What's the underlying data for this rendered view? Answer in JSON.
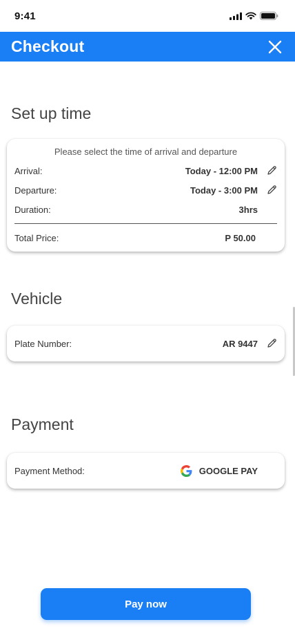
{
  "status_bar": {
    "time": "9:41"
  },
  "header": {
    "title": "Checkout"
  },
  "time_section": {
    "title": "Set up time",
    "note": "Please select the time of arrival and departure",
    "arrival_label": "Arrival:",
    "arrival_value": "Today - 12:00 PM",
    "departure_label": "Departure:",
    "departure_value": "Today - 3:00 PM",
    "duration_label": "Duration:",
    "duration_value": "3hrs",
    "total_label": "Total Price:",
    "total_value": "P 50.00"
  },
  "vehicle_section": {
    "title": "Vehicle",
    "plate_label": "Plate Number:",
    "plate_value": "AR 9447"
  },
  "payment_section": {
    "title": "Payment",
    "method_label": "Payment Method:",
    "method_value": "GOOGLE PAY"
  },
  "pay_button": {
    "label": "Pay now"
  },
  "colors": {
    "accent": "#1a7ef5",
    "background": "#ffffff"
  }
}
